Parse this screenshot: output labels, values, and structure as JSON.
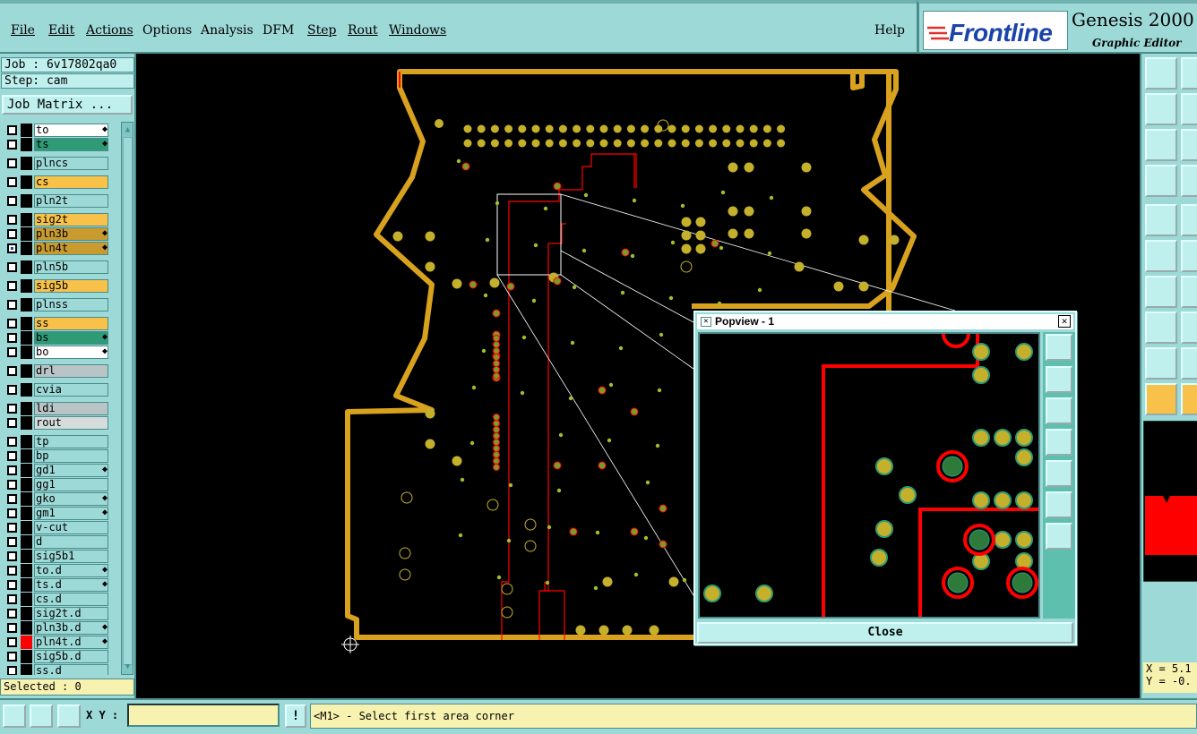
{
  "menubar": {
    "items": [
      "File",
      "Edit",
      "Actions",
      "Options",
      "Analysis",
      "DFM",
      "Step",
      "Rout",
      "Windows"
    ],
    "help": "Help"
  },
  "brand": {
    "logo": "Frontline",
    "product": "Genesis 2000",
    "subtitle": "Graphic Editor"
  },
  "job_info": {
    "job_line": "Job : 6v17802qa0",
    "step_line": "Step: cam",
    "job_matrix_button": "Job Matrix ..."
  },
  "layers": [
    {
      "name": "to",
      "color": "white",
      "affected": true
    },
    {
      "name": "ts",
      "color": "green",
      "affected": true
    },
    {
      "name": "plncs",
      "color": "def",
      "affected": false
    },
    {
      "name": "cs",
      "color": "yellow",
      "affected": false
    },
    {
      "name": "pln2t",
      "color": "def",
      "affected": false
    },
    {
      "name": "sig2t",
      "color": "yellow",
      "affected": false
    },
    {
      "name": "pln3b",
      "color": "brown",
      "affected": true
    },
    {
      "name": "pln4t",
      "color": "brown",
      "affected": true,
      "checked": true
    },
    {
      "name": "pln5b",
      "color": "def",
      "affected": false
    },
    {
      "name": "sig5b",
      "color": "yellow",
      "affected": false
    },
    {
      "name": "plnss",
      "color": "def",
      "affected": false
    },
    {
      "name": "ss",
      "color": "yellow",
      "affected": false
    },
    {
      "name": "bs",
      "color": "green",
      "affected": true
    },
    {
      "name": "bo",
      "color": "white",
      "affected": true
    },
    {
      "name": "drl",
      "color": "grey",
      "affected": false
    },
    {
      "name": "cvia",
      "color": "def",
      "affected": false
    },
    {
      "name": "ldi",
      "color": "grey",
      "affected": false
    },
    {
      "name": "rout",
      "color": "lgrey",
      "affected": false
    },
    {
      "name": "tp",
      "color": "def",
      "affected": false
    },
    {
      "name": "bp",
      "color": "def",
      "affected": false
    },
    {
      "name": "gd1",
      "color": "def",
      "affected": true
    },
    {
      "name": "gg1",
      "color": "def",
      "affected": false
    },
    {
      "name": "gko",
      "color": "def",
      "affected": true
    },
    {
      "name": "gm1",
      "color": "def",
      "affected": true
    },
    {
      "name": "v-cut",
      "color": "def",
      "affected": false
    },
    {
      "name": "d",
      "color": "def",
      "affected": false
    },
    {
      "name": "sig5b1",
      "color": "def",
      "affected": false
    },
    {
      "name": "to.d",
      "color": "def",
      "affected": true
    },
    {
      "name": "ts.d",
      "color": "def",
      "affected": true
    },
    {
      "name": "cs.d",
      "color": "def",
      "affected": false
    },
    {
      "name": "sig2t.d",
      "color": "def",
      "affected": false
    },
    {
      "name": "pln3b.d",
      "color": "def",
      "affected": true
    },
    {
      "name": "pln4t.d",
      "color": "def",
      "affected": true,
      "swatch": "red"
    },
    {
      "name": "sig5b.d",
      "color": "def",
      "affected": false
    },
    {
      "name": "ss.d",
      "color": "def",
      "affected": false
    }
  ],
  "status": {
    "selected": "Selected : 0"
  },
  "popview": {
    "title": "Popview - 1",
    "close_label": "Close"
  },
  "coords": {
    "x_label": "X = 5.1",
    "y_label": "Y = -0."
  },
  "bottombar": {
    "xy_label": "X Y :",
    "xy_value": "",
    "bang": "!",
    "prompt": "<M1> - Select first area corner"
  },
  "colors": {
    "panel": "#9dd9d7",
    "outline": "#d9a21e",
    "pad": "#c4b02a",
    "trace_red": "#ff0000"
  }
}
